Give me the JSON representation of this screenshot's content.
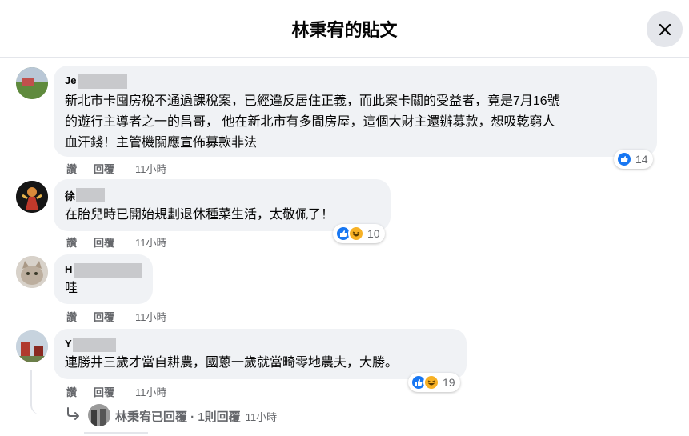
{
  "header": {
    "title": "林秉宥的貼文"
  },
  "actions": {
    "like_label": "讚",
    "reply_label": "回覆"
  },
  "comments": [
    {
      "author": "Je",
      "lines": [
        "新北市卡囤房稅不通過課稅案，已經違反居住正義，而此案卡關的受益者，竟是7月16號",
        "的遊行主導者之一的昌哥， 他在新北市有多間房屋，這個大財主還辦募款，想吸乾窮人",
        "血汗錢！主管機關應宣佈募款非法"
      ],
      "time": "11小時",
      "reaction_count": "14",
      "reactions": [
        "like-icon"
      ]
    },
    {
      "author": "徐",
      "lines": [
        "在胎兒時已開始規劃退休種菜生活，太敬佩了！"
      ],
      "time": "11小時",
      "reaction_count": "10",
      "reactions": [
        "like-icon",
        "haha-icon"
      ]
    },
    {
      "author": "H",
      "lines": [
        "哇"
      ],
      "time": "11小時",
      "reaction_count": "",
      "reactions": []
    },
    {
      "author": "Y",
      "lines": [
        "連勝井三歲才當自耕農，國蔥一歲就當畸零地農夫，大勝。"
      ],
      "time": "11小時",
      "reaction_count": "19",
      "reactions": [
        "like-icon",
        "haha-icon"
      ]
    }
  ],
  "replies": {
    "summary": "林秉宥已回覆 · 1則回覆",
    "time": "11小時"
  },
  "colors": {
    "like": "#1877f2",
    "haha": "#f7b125",
    "bubble": "#f0f2f5",
    "muted": "#65676b"
  }
}
